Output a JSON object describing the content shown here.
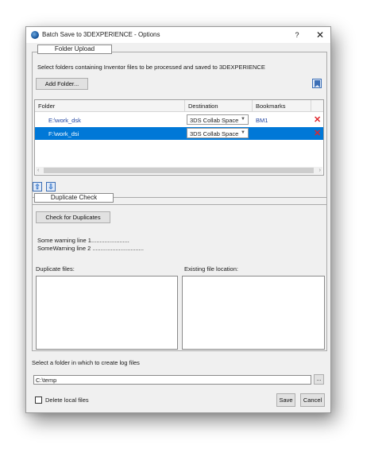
{
  "window": {
    "title": "Batch Save to 3DEXPERIENCE - Options",
    "help_label": "?",
    "close_label": "✕"
  },
  "folder_upload": {
    "group_title": "Folder Upload",
    "instruction": "Select folders containing Inventor files to be processed and saved to 3DEXPERIENCE",
    "add_folder_label": "Add Folder...",
    "bookmark_icon": "bookmark-icon",
    "columns": [
      "Folder",
      "Destination",
      "Bookmarks"
    ],
    "rows": [
      {
        "folder": "E:\\work_dsk",
        "destination": "3DS Collab Space",
        "bookmark": "BM1",
        "selected": false
      },
      {
        "folder": "F:\\work_dsi",
        "destination": "3DS Collab Space",
        "bookmark": "",
        "selected": true
      }
    ],
    "delete_icon": "delete-x-icon",
    "move_up_icon": "up-arrow-icon",
    "move_down_icon": "down-arrow-icon"
  },
  "duplicate_check": {
    "group_title": "Duplicate Check",
    "check_button_label": "Check for Duplicates",
    "warnings": [
      "Some warning line 1.......................",
      "SomeWarning line 2 ..............................."
    ],
    "duplicate_files_label": "Duplicate files:",
    "existing_location_label": "Existing file location:"
  },
  "log": {
    "label": "Select a folder in which to create log files",
    "path_value": "C:\\temp",
    "browse_label": "..."
  },
  "footer": {
    "delete_local_label": "Delete local files",
    "delete_local_checked": false,
    "save_label": "Save",
    "cancel_label": "Cancel"
  },
  "colors": {
    "selection": "#0078d7",
    "link": "#1b3f9e",
    "delete": "#e0262b"
  }
}
